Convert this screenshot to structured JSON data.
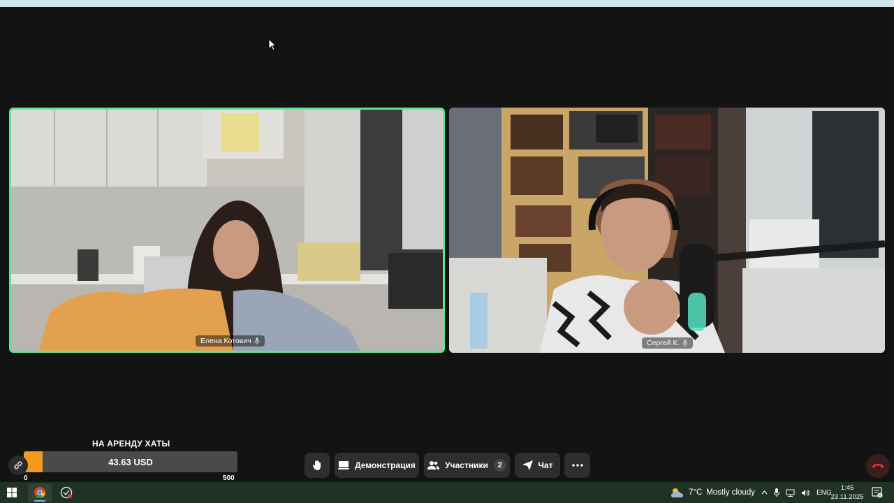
{
  "participants": [
    {
      "name": "Елена Котович",
      "active_speaker": true
    },
    {
      "name": "Сергей К.",
      "active_speaker": false
    }
  ],
  "donation": {
    "title": "НА АРЕНДУ ХАТЫ",
    "amount": "43.63 USD",
    "min": "0",
    "max": "500",
    "progress_fraction": 0.087
  },
  "controls": {
    "raise_hand_icon": "hand-icon",
    "demo_label": "Демонстрация",
    "participants_label": "Участники",
    "participants_count": "2",
    "chat_label": "Чат",
    "more_icon": "more-icon",
    "hangup_icon": "hangup-icon"
  },
  "taskbar": {
    "weather_temp": "7°C",
    "weather_text": "Mostly cloudy",
    "lang": "ENG",
    "time": "1:45",
    "date": "23.11.2025",
    "notification_count": "6"
  },
  "colors": {
    "active_border": "#5fe68c",
    "progress_fill": "#f39a1e",
    "background": "#131313",
    "hangup": "#e0393e"
  }
}
